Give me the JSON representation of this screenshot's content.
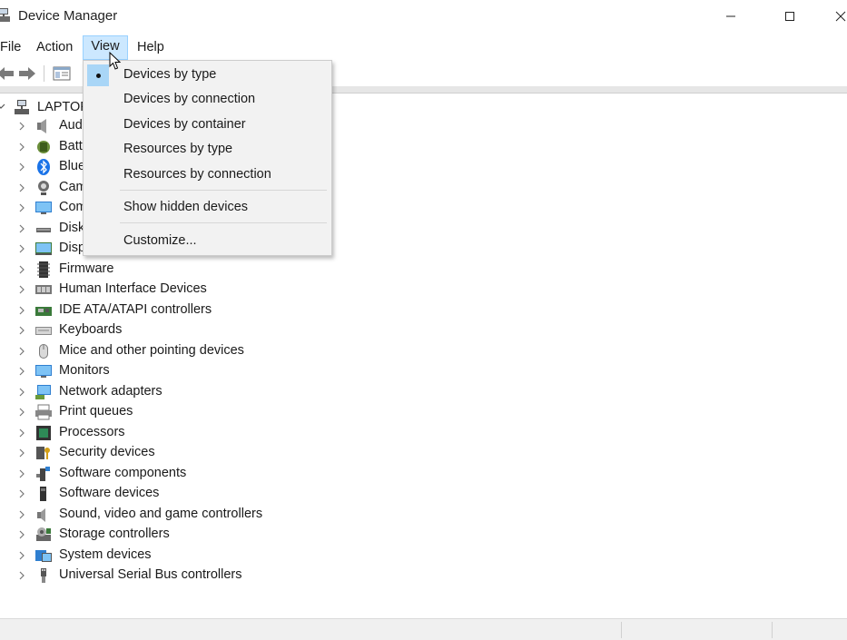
{
  "window": {
    "title": "Device Manager"
  },
  "menubar": {
    "file": "File",
    "action": "Action",
    "view": "View",
    "help": "Help"
  },
  "tree": {
    "root_label": "LAPTOP-",
    "hidden_behind_menu": [
      {
        "label": "Aud",
        "icon": "audio-icon"
      },
      {
        "label": "Batt",
        "icon": "battery-icon"
      },
      {
        "label": "Blue",
        "icon": "bluetooth-icon"
      },
      {
        "label": "Cam",
        "icon": "camera-icon"
      },
      {
        "label": "Com",
        "icon": "computer-icon"
      },
      {
        "label": "Disk",
        "icon": "disk-drive-icon"
      },
      {
        "label": "Disp",
        "icon": "display-adapter-icon"
      }
    ],
    "items": [
      {
        "label": "Firmware",
        "icon": "firmware-icon"
      },
      {
        "label": "Human Interface Devices",
        "icon": "hid-icon"
      },
      {
        "label": "IDE ATA/ATAPI controllers",
        "icon": "ide-controller-icon"
      },
      {
        "label": "Keyboards",
        "icon": "keyboard-icon"
      },
      {
        "label": "Mice and other pointing devices",
        "icon": "mouse-icon"
      },
      {
        "label": "Monitors",
        "icon": "monitor-icon"
      },
      {
        "label": "Network adapters",
        "icon": "network-adapter-icon"
      },
      {
        "label": "Print queues",
        "icon": "printer-icon"
      },
      {
        "label": "Processors",
        "icon": "processor-icon"
      },
      {
        "label": "Security devices",
        "icon": "security-device-icon"
      },
      {
        "label": "Software components",
        "icon": "software-component-icon"
      },
      {
        "label": "Software devices",
        "icon": "software-device-icon"
      },
      {
        "label": "Sound, video and game controllers",
        "icon": "sound-icon"
      },
      {
        "label": "Storage controllers",
        "icon": "storage-controller-icon"
      },
      {
        "label": "System devices",
        "icon": "system-device-icon"
      },
      {
        "label": "Universal Serial Bus controllers",
        "icon": "usb-icon"
      }
    ]
  },
  "view_menu": {
    "items": [
      {
        "label": "Devices by type",
        "checked": true
      },
      {
        "label": "Devices by connection",
        "checked": false
      },
      {
        "label": "Devices by container",
        "checked": false
      },
      {
        "label": "Resources by type",
        "checked": false
      },
      {
        "label": "Resources by connection",
        "checked": false
      },
      {
        "label": "Show hidden devices",
        "checked": false
      },
      {
        "label": "Customize...",
        "checked": false
      }
    ]
  },
  "colors": {
    "menu_highlight": "#cce8ff",
    "menu_highlight_border": "#99d1ff",
    "check_bg": "#a9d6f7",
    "dropdown_bg": "#f2f2f2"
  }
}
